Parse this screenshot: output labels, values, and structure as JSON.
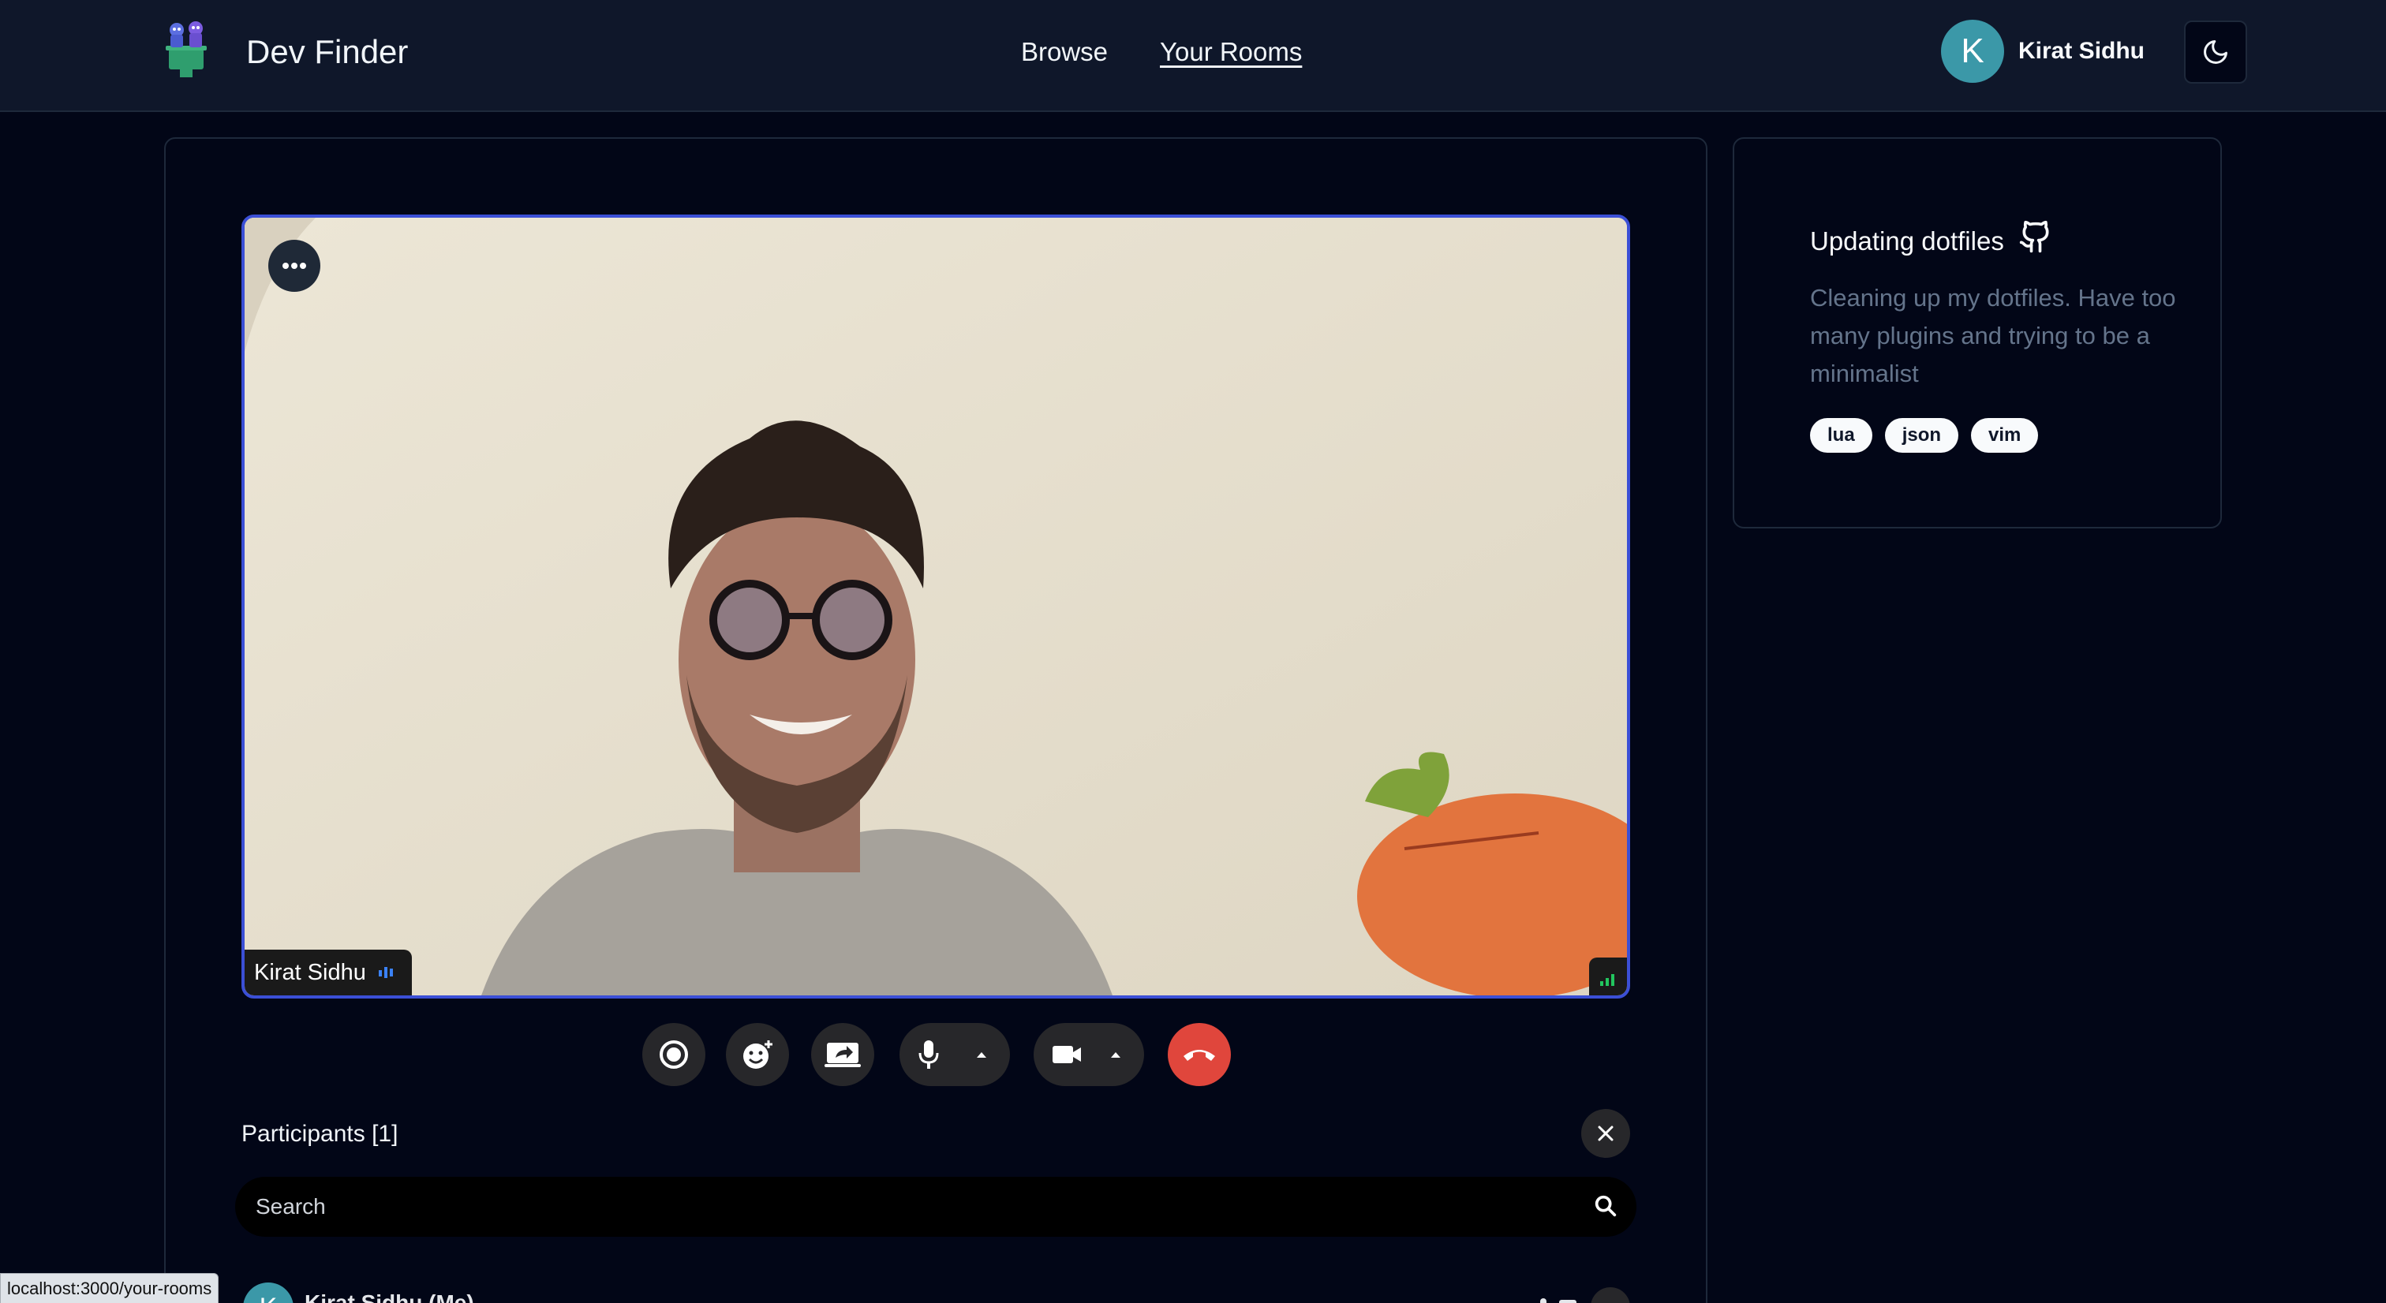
{
  "header": {
    "app_title": "Dev Finder",
    "nav": {
      "browse": "Browse",
      "your_rooms": "Your Rooms"
    },
    "user": {
      "initial": "K",
      "name": "Kirat Sidhu"
    },
    "icons": {
      "logo": "dev-finder-logo",
      "theme": "moon-icon"
    }
  },
  "video": {
    "participant_name": "Kirat Sidhu",
    "icons": {
      "more": "more-horizontal-icon",
      "audio": "audio-level-icon",
      "signal": "signal-strength-icon"
    }
  },
  "controls": {
    "icons": [
      "record-icon",
      "emoji-reaction-icon",
      "screen-share-icon",
      "microphone-icon",
      "camera-icon",
      "hang-up-icon"
    ]
  },
  "participants": {
    "title": "Participants [1]",
    "search_placeholder": "Search",
    "list": [
      {
        "initial": "K",
        "name": "Kirat Sidhu (Me)"
      }
    ]
  },
  "room": {
    "title": "Updating dotfiles",
    "description": "Cleaning up my dotfiles. Have too many plugins and trying to be a minimalist",
    "tags": [
      "lua",
      "json",
      "vim"
    ],
    "icons": {
      "repo": "github-icon"
    }
  },
  "status_bar": {
    "url": "localhost:3000/your-rooms"
  },
  "colors": {
    "background": "#020617",
    "header": "#0f172a",
    "video_border": "#3b4fd6",
    "avatar": "#3b98a8",
    "leave_button": "#e0463c"
  }
}
